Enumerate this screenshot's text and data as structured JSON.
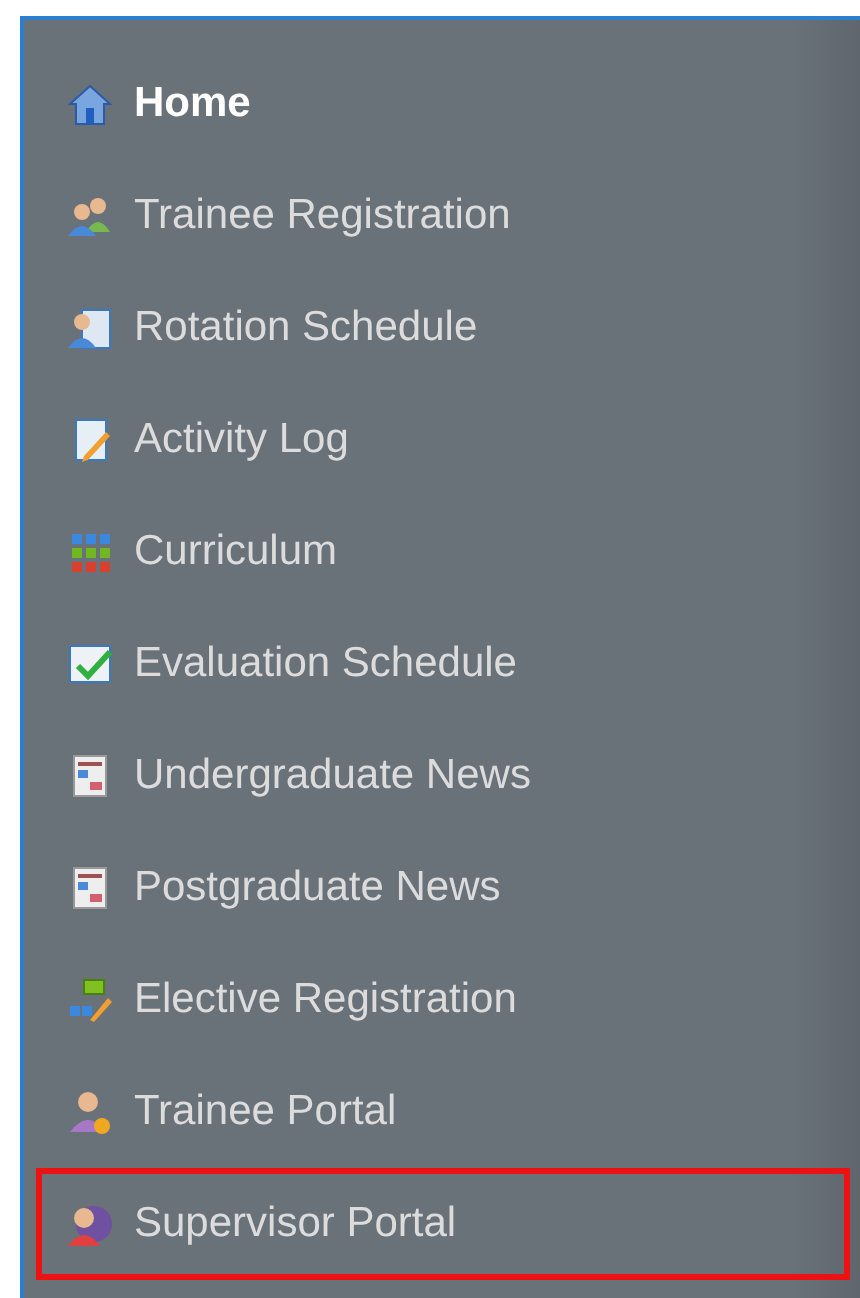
{
  "menu": {
    "items": [
      {
        "label": "Home",
        "selected": true,
        "highlighted": false
      },
      {
        "label": "Trainee Registration",
        "selected": false,
        "highlighted": false
      },
      {
        "label": "Rotation Schedule",
        "selected": false,
        "highlighted": false
      },
      {
        "label": "Activity Log",
        "selected": false,
        "highlighted": false
      },
      {
        "label": "Curriculum",
        "selected": false,
        "highlighted": false
      },
      {
        "label": "Evaluation Schedule",
        "selected": false,
        "highlighted": false
      },
      {
        "label": "Undergraduate News",
        "selected": false,
        "highlighted": false
      },
      {
        "label": "Postgraduate News",
        "selected": false,
        "highlighted": false
      },
      {
        "label": "Elective Registration",
        "selected": false,
        "highlighted": false
      },
      {
        "label": "Trainee Portal",
        "selected": false,
        "highlighted": false
      },
      {
        "label": "Supervisor Portal",
        "selected": false,
        "highlighted": true
      }
    ]
  }
}
